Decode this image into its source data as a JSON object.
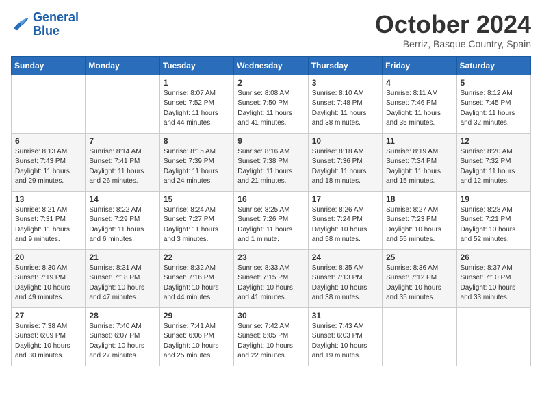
{
  "header": {
    "logo_line1": "General",
    "logo_line2": "Blue",
    "month": "October 2024",
    "location": "Berriz, Basque Country, Spain"
  },
  "columns": [
    "Sunday",
    "Monday",
    "Tuesday",
    "Wednesday",
    "Thursday",
    "Friday",
    "Saturday"
  ],
  "weeks": [
    [
      {
        "day": "",
        "info": ""
      },
      {
        "day": "",
        "info": ""
      },
      {
        "day": "1",
        "info": "Sunrise: 8:07 AM\nSunset: 7:52 PM\nDaylight: 11 hours and 44 minutes."
      },
      {
        "day": "2",
        "info": "Sunrise: 8:08 AM\nSunset: 7:50 PM\nDaylight: 11 hours and 41 minutes."
      },
      {
        "day": "3",
        "info": "Sunrise: 8:10 AM\nSunset: 7:48 PM\nDaylight: 11 hours and 38 minutes."
      },
      {
        "day": "4",
        "info": "Sunrise: 8:11 AM\nSunset: 7:46 PM\nDaylight: 11 hours and 35 minutes."
      },
      {
        "day": "5",
        "info": "Sunrise: 8:12 AM\nSunset: 7:45 PM\nDaylight: 11 hours and 32 minutes."
      }
    ],
    [
      {
        "day": "6",
        "info": "Sunrise: 8:13 AM\nSunset: 7:43 PM\nDaylight: 11 hours and 29 minutes."
      },
      {
        "day": "7",
        "info": "Sunrise: 8:14 AM\nSunset: 7:41 PM\nDaylight: 11 hours and 26 minutes."
      },
      {
        "day": "8",
        "info": "Sunrise: 8:15 AM\nSunset: 7:39 PM\nDaylight: 11 hours and 24 minutes."
      },
      {
        "day": "9",
        "info": "Sunrise: 8:16 AM\nSunset: 7:38 PM\nDaylight: 11 hours and 21 minutes."
      },
      {
        "day": "10",
        "info": "Sunrise: 8:18 AM\nSunset: 7:36 PM\nDaylight: 11 hours and 18 minutes."
      },
      {
        "day": "11",
        "info": "Sunrise: 8:19 AM\nSunset: 7:34 PM\nDaylight: 11 hours and 15 minutes."
      },
      {
        "day": "12",
        "info": "Sunrise: 8:20 AM\nSunset: 7:32 PM\nDaylight: 11 hours and 12 minutes."
      }
    ],
    [
      {
        "day": "13",
        "info": "Sunrise: 8:21 AM\nSunset: 7:31 PM\nDaylight: 11 hours and 9 minutes."
      },
      {
        "day": "14",
        "info": "Sunrise: 8:22 AM\nSunset: 7:29 PM\nDaylight: 11 hours and 6 minutes."
      },
      {
        "day": "15",
        "info": "Sunrise: 8:24 AM\nSunset: 7:27 PM\nDaylight: 11 hours and 3 minutes."
      },
      {
        "day": "16",
        "info": "Sunrise: 8:25 AM\nSunset: 7:26 PM\nDaylight: 11 hours and 1 minute."
      },
      {
        "day": "17",
        "info": "Sunrise: 8:26 AM\nSunset: 7:24 PM\nDaylight: 10 hours and 58 minutes."
      },
      {
        "day": "18",
        "info": "Sunrise: 8:27 AM\nSunset: 7:23 PM\nDaylight: 10 hours and 55 minutes."
      },
      {
        "day": "19",
        "info": "Sunrise: 8:28 AM\nSunset: 7:21 PM\nDaylight: 10 hours and 52 minutes."
      }
    ],
    [
      {
        "day": "20",
        "info": "Sunrise: 8:30 AM\nSunset: 7:19 PM\nDaylight: 10 hours and 49 minutes."
      },
      {
        "day": "21",
        "info": "Sunrise: 8:31 AM\nSunset: 7:18 PM\nDaylight: 10 hours and 47 minutes."
      },
      {
        "day": "22",
        "info": "Sunrise: 8:32 AM\nSunset: 7:16 PM\nDaylight: 10 hours and 44 minutes."
      },
      {
        "day": "23",
        "info": "Sunrise: 8:33 AM\nSunset: 7:15 PM\nDaylight: 10 hours and 41 minutes."
      },
      {
        "day": "24",
        "info": "Sunrise: 8:35 AM\nSunset: 7:13 PM\nDaylight: 10 hours and 38 minutes."
      },
      {
        "day": "25",
        "info": "Sunrise: 8:36 AM\nSunset: 7:12 PM\nDaylight: 10 hours and 35 minutes."
      },
      {
        "day": "26",
        "info": "Sunrise: 8:37 AM\nSunset: 7:10 PM\nDaylight: 10 hours and 33 minutes."
      }
    ],
    [
      {
        "day": "27",
        "info": "Sunrise: 7:38 AM\nSunset: 6:09 PM\nDaylight: 10 hours and 30 minutes."
      },
      {
        "day": "28",
        "info": "Sunrise: 7:40 AM\nSunset: 6:07 PM\nDaylight: 10 hours and 27 minutes."
      },
      {
        "day": "29",
        "info": "Sunrise: 7:41 AM\nSunset: 6:06 PM\nDaylight: 10 hours and 25 minutes."
      },
      {
        "day": "30",
        "info": "Sunrise: 7:42 AM\nSunset: 6:05 PM\nDaylight: 10 hours and 22 minutes."
      },
      {
        "day": "31",
        "info": "Sunrise: 7:43 AM\nSunset: 6:03 PM\nDaylight: 10 hours and 19 minutes."
      },
      {
        "day": "",
        "info": ""
      },
      {
        "day": "",
        "info": ""
      }
    ]
  ]
}
